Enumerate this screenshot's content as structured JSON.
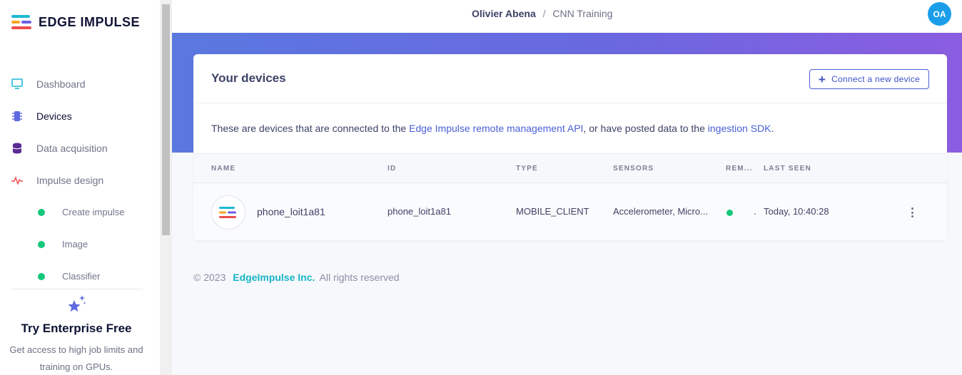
{
  "brand": {
    "name": "EDGE IMPULSE"
  },
  "sidebar": {
    "items": [
      {
        "label": "Dashboard",
        "icon": "monitor-icon"
      },
      {
        "label": "Devices",
        "icon": "chip-icon"
      },
      {
        "label": "Data acquisition",
        "icon": "database-icon"
      },
      {
        "label": "Impulse design",
        "icon": "pulse-icon"
      }
    ],
    "subitems": [
      {
        "label": "Create impulse"
      },
      {
        "label": "Image"
      },
      {
        "label": "Classifier"
      }
    ],
    "enterprise": {
      "title": "Try Enterprise Free",
      "text": "Get access to high job limits and training on GPUs."
    }
  },
  "header": {
    "user": "Olivier Abena",
    "separator": "/",
    "project": "CNN Training",
    "avatar_initials": "OA"
  },
  "devices": {
    "title": "Your devices",
    "connect_label": "Connect a new device",
    "desc_prefix": "These are devices that are connected to the ",
    "desc_link1": "Edge Impulse remote management API",
    "desc_middle": ", or have posted data to the ",
    "desc_link2": "ingestion SDK",
    "desc_suffix": ".",
    "columns": {
      "name": "NAME",
      "id": "ID",
      "type": "TYPE",
      "sensors": "SENSORS",
      "remote": "REM...",
      "last_seen": "LAST SEEN"
    },
    "rows": [
      {
        "name": "phone_loit1a81",
        "id": "phone_loit1a81",
        "type": "MOBILE_CLIENT",
        "sensors": "Accelerometer, Micro...",
        "remote_extra": ".",
        "last_seen": "Today, 10:40:28"
      }
    ]
  },
  "footer": {
    "copyright": "© 2023",
    "brand": "EdgeImpulse Inc.",
    "rights": "All rights reserved"
  },
  "colors": {
    "accent": "#4a5fd6",
    "teal": "#18b5c7",
    "online": "#14c77a",
    "avatar": "#1a9eea",
    "banner_start": "#5a78e0",
    "banner_end": "#8b5de0"
  }
}
